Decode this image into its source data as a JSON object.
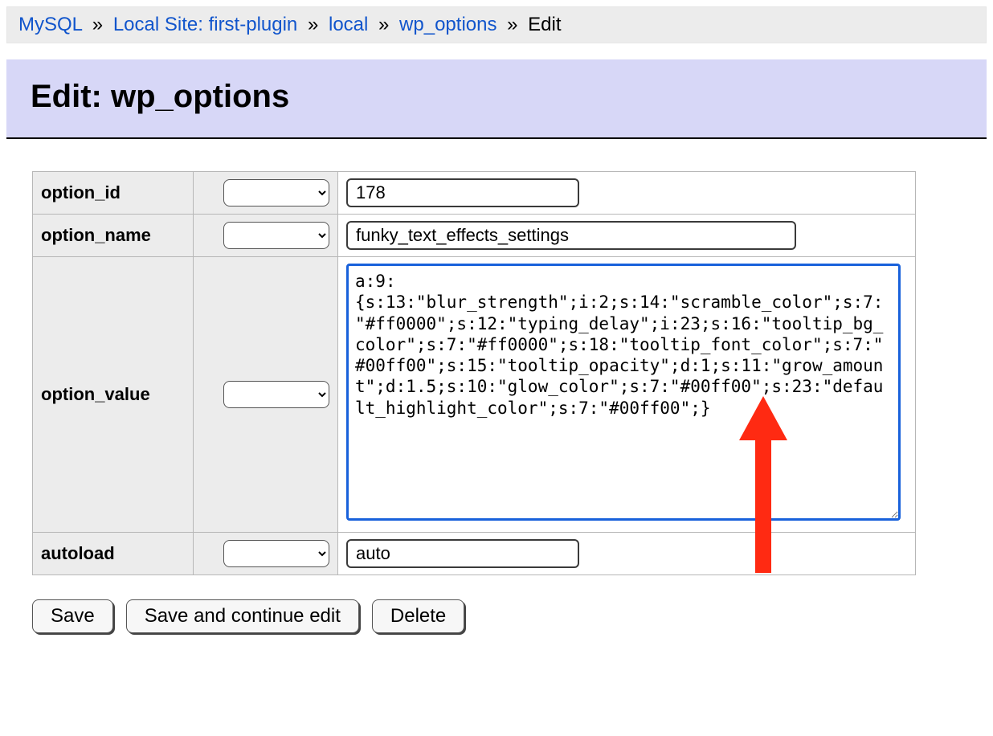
{
  "breadcrumb": {
    "items": [
      {
        "label": "MySQL",
        "link": true
      },
      {
        "label": "Local Site: first-plugin",
        "link": true
      },
      {
        "label": "local",
        "link": true
      },
      {
        "label": "wp_options",
        "link": true
      },
      {
        "label": "Edit",
        "link": false
      }
    ]
  },
  "page_title": "Edit: wp_options",
  "fields": {
    "option_id": {
      "label": "option_id",
      "value": "178"
    },
    "option_name": {
      "label": "option_name",
      "value": "funky_text_effects_settings"
    },
    "option_value": {
      "label": "option_value",
      "value": "a:9:{s:13:\"blur_strength\";i:2;s:14:\"scramble_color\";s:7:\"#ff0000\";s:12:\"typing_delay\";i:23;s:16:\"tooltip_bg_color\";s:7:\"#ff0000\";s:18:\"tooltip_font_color\";s:7:\"#00ff00\";s:15:\"tooltip_opacity\";d:1;s:11:\"grow_amount\";d:1.5;s:10:\"glow_color\";s:7:\"#00ff00\";s:23:\"default_highlight_color\";s:7:\"#00ff00\";}"
    },
    "autoload": {
      "label": "autoload",
      "value": "auto"
    }
  },
  "buttons": {
    "save": "Save",
    "save_continue": "Save and continue edit",
    "delete": "Delete"
  },
  "annotation": {
    "arrow_color": "#ff2a12"
  }
}
